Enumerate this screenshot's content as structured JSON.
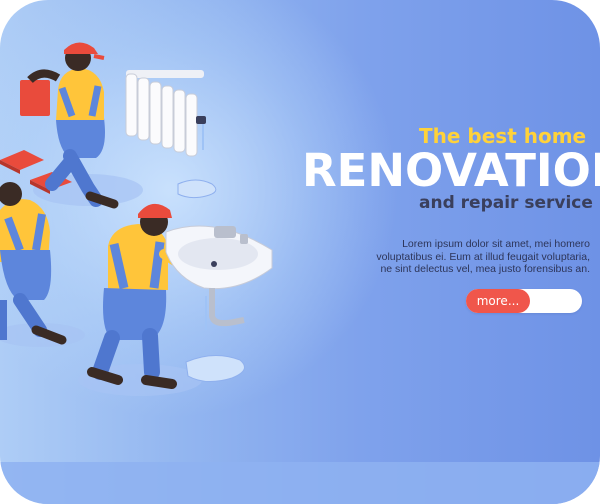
{
  "hero": {
    "tagline": "The best home",
    "title": "RENOVATION",
    "subtitle": "and repair service",
    "body_lines": [
      "Lorem ipsum dolor sit amet, mei homero",
      "voluptatibus ei. Eum at illud feugait voluptaria,",
      "ne sint delectus vel, mea justo forensibus an."
    ],
    "more_label": "more..."
  },
  "colors": {
    "tagline": "#ffd23a",
    "title": "#ffffff",
    "subtitle": "#3a3f5c",
    "button": "#f0564b",
    "worker_overalls": "#5d86dc",
    "worker_shirt": "#ffc53a",
    "worker_cap": "#e94b3c"
  },
  "illustration": {
    "icons": [
      "plumber-worker",
      "tiler-worker",
      "radiator",
      "sink",
      "water-puddle",
      "floor-tiles"
    ]
  }
}
